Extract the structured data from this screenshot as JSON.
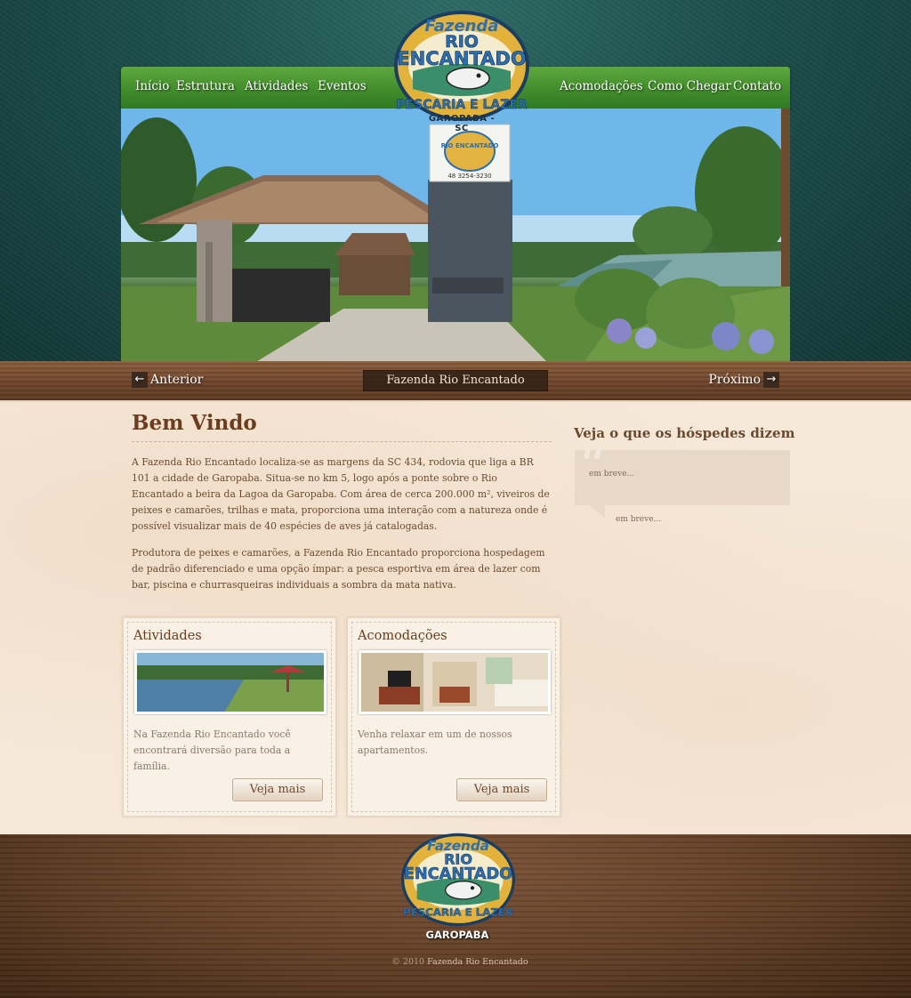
{
  "nav": {
    "items": [
      "Início",
      "Estrutura",
      "Atividades",
      "Eventos",
      "Acomodações",
      "Como Chegar",
      "Contato"
    ]
  },
  "logo": {
    "line1": "Fazenda",
    "line2": "RIO",
    "line3": "ENCANTADO",
    "line4": "PESCARIA E LAZER",
    "city": "GAROPABA - SC"
  },
  "slider": {
    "prev_label": "Anterior",
    "next_label": "Próximo",
    "caption": "Fazenda Rio Encantado",
    "sign_text": "RIO ENCANTADO",
    "sign_phone": "48 3254-3230"
  },
  "welcome": {
    "title": "Bem Vindo",
    "paragraphs": [
      "A Fazenda Rio Encantado localiza-se as margens da SC 434, rodovia que liga a BR 101 a cidade de Garopaba. Situa-se no km 5, logo após a ponte sobre o Rio Encantado a beira da Lagoa da Garopaba. Com área de cerca 200.000 m², viveiros de peixes e camarões, trilhas e mata, proporciona uma interação com a natureza onde é possível visualizar mais de 40 espécies de aves já catalogadas.",
      "Produtora de peixes e camarões, a Fazenda Rio Encantado proporciona hospedagem de padrão diferenciado e uma opção ímpar: a pesca esportiva em área de lazer com bar, piscina e churrasqueiras individuais a sombra da mata nativa."
    ]
  },
  "boxes": [
    {
      "title": "Atividades",
      "text": "Na Fazenda Rio Encantado você encontrará diversão para toda a família.",
      "button": "Veja mais"
    },
    {
      "title": "Acomodações",
      "text": "Venha relaxar em um de nossos apartamentos.",
      "button": "Veja mais"
    }
  ],
  "sidebar": {
    "title": "Veja o que os hóspedes dizem",
    "quote": "em breve...",
    "author": "em breve..."
  },
  "footer": {
    "city": "GAROPABA",
    "copyright_symbol": "© 2010",
    "copyright_name": "Fazenda Rio Encantado"
  },
  "colors": {
    "nav_green": "#3f8a2a",
    "heading_brown": "#6b3d1e",
    "teal_bg": "#1d4f4c",
    "logo_blue": "#2a6fb5",
    "logo_gold": "#e2b23a"
  },
  "icons": [
    "arrow-left-icon",
    "arrow-right-icon",
    "quote-icon"
  ]
}
